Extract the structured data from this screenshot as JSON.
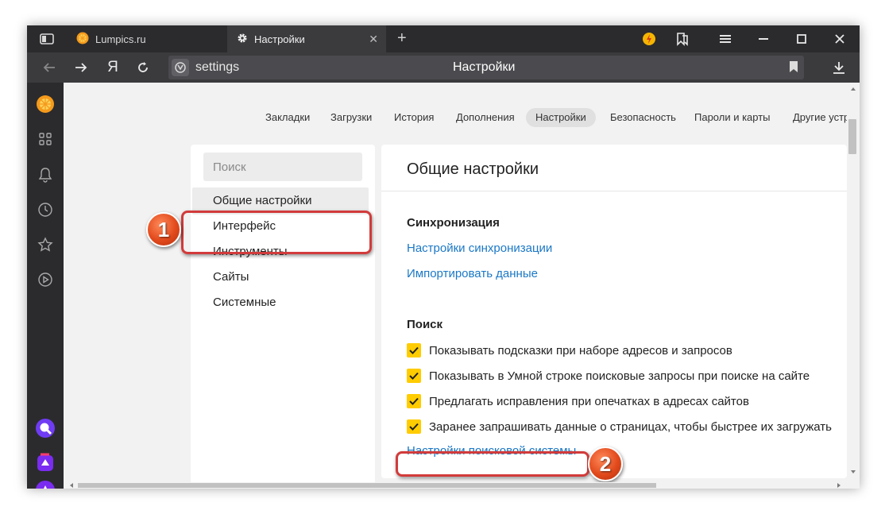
{
  "tabs": [
    {
      "label": "Lumpics.ru"
    },
    {
      "label": "Настройки"
    }
  ],
  "toolbar": {
    "url": "settings",
    "page_title": "Настройки",
    "yandex_glyph": "Я"
  },
  "topnav": {
    "items": [
      "Закладки",
      "Загрузки",
      "История",
      "Дополнения",
      "Настройки",
      "Безопасность",
      "Пароли и карты",
      "Другие устр"
    ],
    "active": "Настройки"
  },
  "left_menu": {
    "search_placeholder": "Поиск",
    "items": [
      "Общие настройки",
      "Интерфейс",
      "Инструменты",
      "Сайты",
      "Системные"
    ],
    "active": "Общие настройки"
  },
  "main": {
    "title": "Общие настройки",
    "sync": {
      "heading": "Синхронизация",
      "links": [
        "Настройки синхронизации",
        "Импортировать данные"
      ]
    },
    "search": {
      "heading": "Поиск",
      "checkboxes": [
        {
          "label": "Показывать подсказки при наборе адресов и запросов",
          "checked": true
        },
        {
          "label": "Показывать в Умной строке поисковые запросы при поиске на сайте",
          "checked": true
        },
        {
          "label": "Предлагать исправления при опечатках в адресах сайтов",
          "checked": true
        },
        {
          "label": "Заранее запрашивать данные о страницах, чтобы быстрее их загружать",
          "checked": true
        }
      ],
      "engine_link": "Настройки поисковой системы"
    }
  },
  "annotations": {
    "badge1": "1",
    "badge2": "2"
  },
  "colors": {
    "accent_link": "#1b78c6",
    "checkbox": "#ffcc00",
    "highlight": "#d23b3b",
    "dark_chrome": "#2b2b2e"
  },
  "icons": [
    "tab-panels-icon",
    "lumpics-favicon",
    "gear-icon",
    "close-icon",
    "plus-icon",
    "protect-icon",
    "bookmarks-icon",
    "menu-icon",
    "minimize-icon",
    "maximize-icon",
    "back-arrow-icon",
    "forward-arrow-icon",
    "yandex-icon",
    "reload-icon",
    "shield-icon",
    "bookmark-icon",
    "download-icon",
    "zen-icon",
    "services-icon",
    "bell-icon",
    "history-icon",
    "star-icon",
    "play-icon",
    "alice-icon",
    "market-icon",
    "assistant-icon"
  ]
}
